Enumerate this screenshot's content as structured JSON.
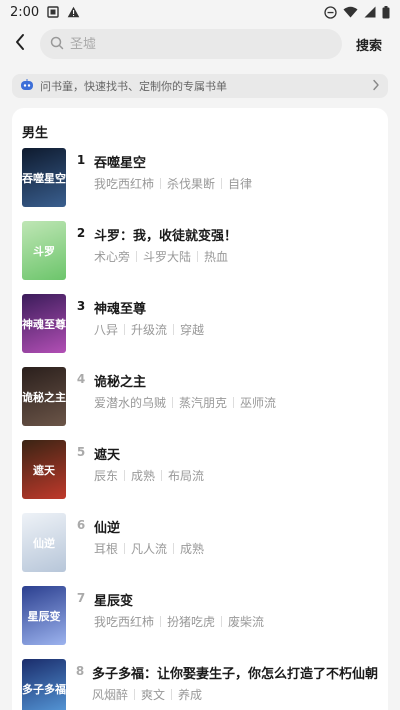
{
  "status_bar": {
    "time": "2:00"
  },
  "search": {
    "placeholder": "圣墟",
    "button_label": "搜索"
  },
  "banner": {
    "text": "问书童，快速找书、定制你的专属书单"
  },
  "section": {
    "title": "男生"
  },
  "books": [
    {
      "rank": "1",
      "title": "吞噬星空",
      "tags": [
        "我吃西红柿",
        "杀伐果断",
        "自律"
      ],
      "cover_text": "吞噬星空",
      "cover_colors": [
        "#0e1a2e",
        "#3a5f8f"
      ]
    },
    {
      "rank": "2",
      "title": "斗罗：我，收徒就变强！",
      "tags": [
        "术心旁",
        "斗罗大陆",
        "热血"
      ],
      "cover_text": "斗罗",
      "cover_colors": [
        "#bfe6b5",
        "#6cc56b"
      ]
    },
    {
      "rank": "3",
      "title": "神魂至尊",
      "tags": [
        "八异",
        "升级流",
        "穿越"
      ],
      "cover_text": "神魂至尊",
      "cover_colors": [
        "#3b1c5a",
        "#b24fb5"
      ]
    },
    {
      "rank": "4",
      "title": "诡秘之主",
      "tags": [
        "爱潜水的乌贼",
        "蒸汽朋克",
        "巫师流"
      ],
      "cover_text": "诡秘之主",
      "cover_colors": [
        "#2a1f1c",
        "#6b5548"
      ]
    },
    {
      "rank": "5",
      "title": "遮天",
      "tags": [
        "辰东",
        "成熟",
        "布局流"
      ],
      "cover_text": "遮天",
      "cover_colors": [
        "#3a2414",
        "#c0392b"
      ]
    },
    {
      "rank": "6",
      "title": "仙逆",
      "tags": [
        "耳根",
        "凡人流",
        "成熟"
      ],
      "cover_text": "仙逆",
      "cover_colors": [
        "#eef2f7",
        "#b7c6d9"
      ]
    },
    {
      "rank": "7",
      "title": "星辰变",
      "tags": [
        "我吃西红柿",
        "扮猪吃虎",
        "废柴流"
      ],
      "cover_text": "星辰变",
      "cover_colors": [
        "#2b3f8f",
        "#9cb3ee"
      ]
    },
    {
      "rank": "8",
      "title": "多子多福：让你娶妻生子，你怎么打造了不朽仙朝",
      "tags": [
        "风烟醉",
        "爽文",
        "养成"
      ],
      "cover_text": "多子多福",
      "cover_colors": [
        "#1a2c6b",
        "#5aa0e0"
      ]
    }
  ],
  "colors": {
    "rank_top": "#1a1a1a",
    "rank_normal": "#aaaaaa",
    "tag": "#999999"
  },
  "icons": {
    "back": "chevron-left",
    "search": "magnifier",
    "robot": "robot",
    "chevron": "chevron-right"
  }
}
